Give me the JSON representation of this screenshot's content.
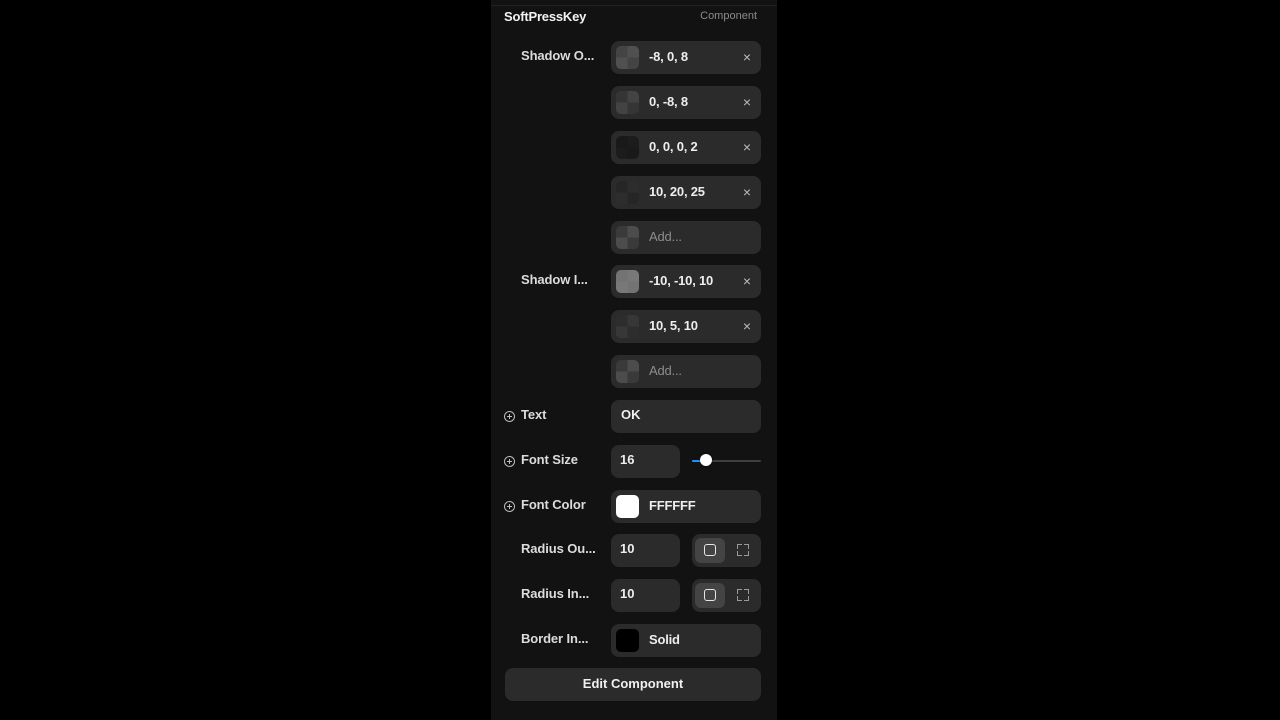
{
  "panel": {
    "title": "SoftPressKey",
    "subtitle": "Component"
  },
  "shadow_outer": {
    "label": "Shadow O...",
    "items": [
      {
        "value": "-8, 0, 8",
        "swatch_tint": "rgba(90,90,90,0.35)"
      },
      {
        "value": "0, -8, 8",
        "swatch_tint": "rgba(40,40,40,0.25)"
      },
      {
        "value": "0, 0, 0, 2",
        "swatch_tint": "rgba(20,20,20,0.85)"
      },
      {
        "value": "10, 20, 25",
        "swatch_tint": "rgba(25,25,25,0.6)"
      }
    ],
    "add_placeholder": "Add..."
  },
  "shadow_inner": {
    "label": "Shadow I...",
    "items": [
      {
        "value": "-10, -10, 10",
        "swatch_tint": "rgba(140,140,140,0.7)"
      },
      {
        "value": "10, 5, 10",
        "swatch_tint": "rgba(30,30,30,0.45)"
      }
    ],
    "add_placeholder": "Add..."
  },
  "text": {
    "label": "Text",
    "value": "OK"
  },
  "font_size": {
    "label": "Font Size",
    "value": "16",
    "slider_fraction": 0.2
  },
  "font_color": {
    "label": "Font Color",
    "value": "FFFFFF",
    "color": "#FFFFFF"
  },
  "radius_outer": {
    "label": "Radius Ou...",
    "value": "10"
  },
  "radius_inner": {
    "label": "Radius In...",
    "value": "10"
  },
  "border_inner": {
    "label": "Border In...",
    "value": "Solid",
    "color": "#000000"
  },
  "edit_button": {
    "label": "Edit Component"
  },
  "icons": {
    "remove": "close-icon",
    "add": "plus-circle-icon",
    "radius_uniform": "square-icon",
    "radius_individual": "corners-icon"
  }
}
